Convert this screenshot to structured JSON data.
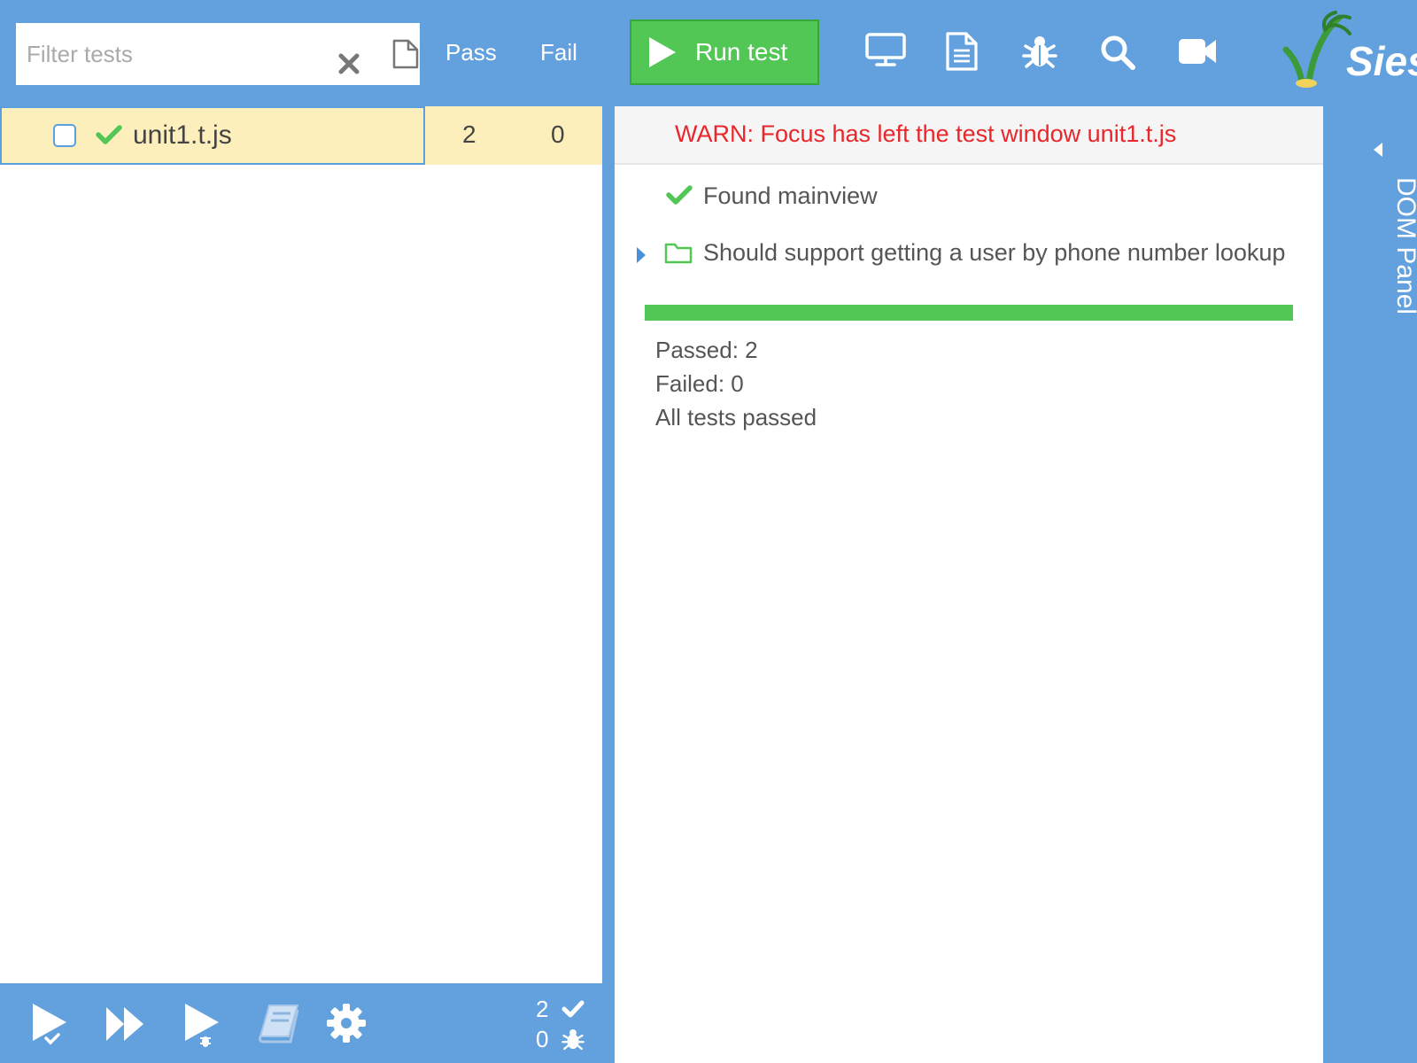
{
  "toolbar": {
    "filter_placeholder": "Filter tests",
    "pass_header": "Pass",
    "fail_header": "Fail",
    "run_button_label": "Run test",
    "icons": [
      "clear-icon",
      "file-icon",
      "monitor-icon",
      "document-icon",
      "bug-icon",
      "search-icon",
      "video-camera-icon"
    ],
    "logo_text": "Sies"
  },
  "test_list": {
    "rows": [
      {
        "name": "unit1.t.js",
        "status": "passed",
        "pass": "2",
        "fail": "0",
        "checked": false
      }
    ]
  },
  "bottom_bar": {
    "icons": [
      "run-checked-icon",
      "run-all-icon",
      "run-failed-icon",
      "book-icon",
      "settings-gear-icon"
    ],
    "pass_count": "2",
    "fail_count": "0"
  },
  "result": {
    "warning": "WARN: Focus has left the test window unit1.t.js",
    "assertions": [
      {
        "text": "Found mainview",
        "status": "passed"
      }
    ],
    "groups": [
      {
        "text": "Should support getting a user by phone number lookup",
        "collapsed": true
      }
    ],
    "progress_fraction": 1.0,
    "summary": {
      "passed": "Passed: 2",
      "failed": "Failed: 0",
      "message": "All tests passed"
    }
  },
  "dom_panel": {
    "label": "DOM Panel"
  },
  "colors": {
    "accent_blue": "#62a1dd",
    "pass_green": "#52c756",
    "warn_red": "#e8262b",
    "selected_row": "#fdefbb"
  }
}
